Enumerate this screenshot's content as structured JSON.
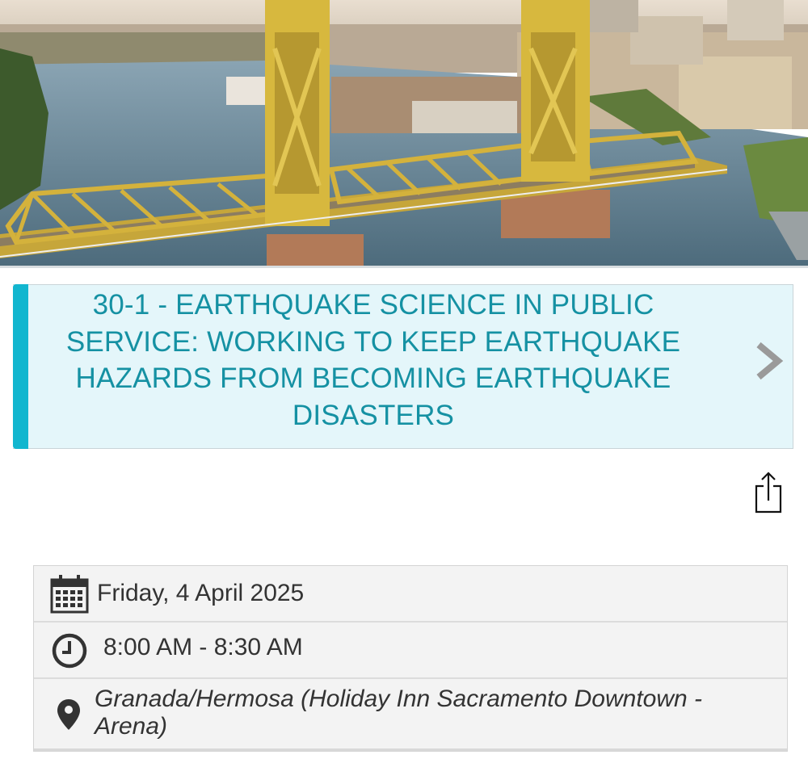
{
  "header": {
    "banner_image": "tower-bridge-sacramento-photo"
  },
  "session": {
    "title": "30-1 - EARTHQUAKE SCIENCE IN PUBLIC SERVICE: WORKING TO KEEP EARTHQUAKE HAZARDS FROM BECOMING EARTHQUAKE DISASTERS",
    "accent_color": "#12b6cf",
    "title_color": "#1591a3",
    "chevron_icon": "chevron-right-icon"
  },
  "actions": {
    "share_icon": "share-icon"
  },
  "details": {
    "date": "Friday, 4 April 2025",
    "time": "8:00 AM - 8:30 AM",
    "location": "Granada/Hermosa (Holiday Inn Sacramento Downtown - Arena)",
    "date_icon": "calendar-icon",
    "time_icon": "clock-icon",
    "location_icon": "map-pin-icon"
  }
}
